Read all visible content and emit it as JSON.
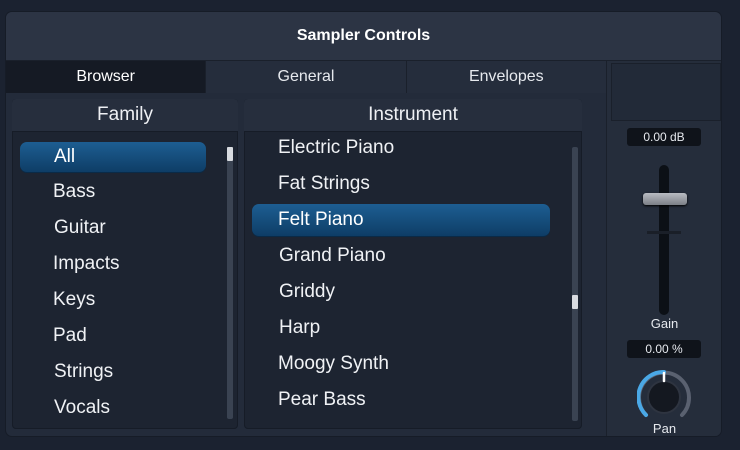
{
  "window": {
    "title": "Sampler Controls"
  },
  "tabs": [
    {
      "label": "Browser",
      "active": true
    },
    {
      "label": "General",
      "active": false
    },
    {
      "label": "Envelopes",
      "active": false
    }
  ],
  "family": {
    "header": "Family",
    "selected": "All",
    "items": [
      "All",
      "Bass",
      "Guitar",
      "Impacts",
      "Keys",
      "Pad",
      "Strings",
      "Vocals"
    ]
  },
  "instrument": {
    "header": "Instrument",
    "selected": "Felt Piano",
    "items": [
      "Electric Piano",
      "Fat Strings",
      "Felt Piano",
      "Grand Piano",
      "Griddy",
      "Harp",
      "Moogy Synth",
      "Pear Bass"
    ]
  },
  "gain": {
    "readout": "0.00 dB",
    "label": "Gain"
  },
  "pan": {
    "readout": "0.00 %",
    "label": "Pan"
  },
  "colors": {
    "accent": "#1d5e92",
    "knob_ring": "#4aa8e6",
    "background": "#1b2230"
  }
}
